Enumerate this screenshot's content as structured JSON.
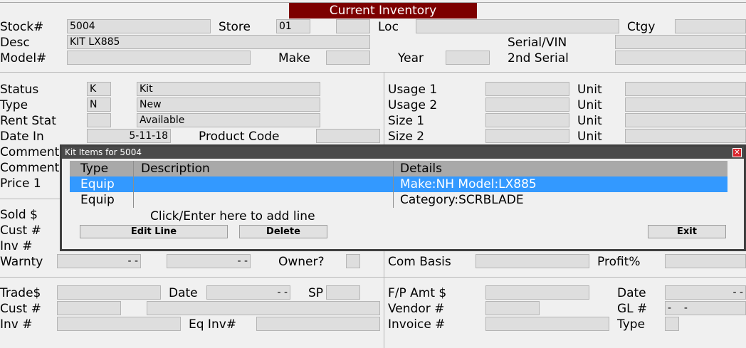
{
  "window": {
    "title": "Current Inventory"
  },
  "header": {
    "stock_label": "Stock#",
    "stock_value": "5004",
    "store_label": "Store",
    "store_value": "01",
    "store_value2": "",
    "loc_label": "Loc",
    "loc_value": "",
    "ctgy_label": "Ctgy",
    "ctgy_value": "",
    "desc_label": "Desc",
    "desc_value": "KIT LX885",
    "serial_label": "Serial/VIN",
    "serial_value": "",
    "model_label": "Model#",
    "model_value": "",
    "make_label": "Make",
    "make_value": "",
    "year_label": "Year",
    "year_value": "",
    "serial2_label": "2nd Serial",
    "serial2_value": ""
  },
  "status": {
    "status_label": "Status",
    "status_code": "K",
    "status_text": "Kit",
    "type_label": "Type",
    "type_code": "N",
    "type_text": "New",
    "rent_label": "Rent Stat",
    "rent_code": "",
    "rent_text": "Available",
    "datein_label": "Date In",
    "datein_value": "5-11-18",
    "product_code_label": "Product Code",
    "product_code_value": "",
    "comment1_label": "Comment",
    "comment2_label": "Comment",
    "price1_label": "Price 1"
  },
  "usage": {
    "usage1_label": "Usage 1",
    "usage2_label": "Usage 2",
    "size1_label": "Size 1",
    "size2_label": "Size 2",
    "unit_label": "Unit"
  },
  "sale": {
    "sold_label": "Sold $",
    "cust_label": "Cust #",
    "inv_label": "Inv #",
    "warnty_label": "Warnty",
    "warnty_value1": "- -",
    "warnty_value2": "- -",
    "owner_label": "Owner?",
    "com_basis_label": "Com Basis",
    "profit_label": "Profit%"
  },
  "trade": {
    "trade_label": "Trade$",
    "date_label": "Date",
    "date_value": "- -",
    "sp_label": "SP",
    "cust_label": "Cust #",
    "inv_label": "Inv #",
    "eq_inv_label": "Eq Inv#",
    "fp_amt_label": "F/P Amt $",
    "vendor_label": "Vendor #",
    "invoice_label": "Invoice #",
    "date2_label": "Date",
    "date2_value": "- -",
    "gl_label": "GL #",
    "gl_value": "-    -",
    "type_label": "Type"
  },
  "kit_dialog": {
    "title": "Kit Items for 5004",
    "columns": [
      "Type",
      "Description",
      "Details"
    ],
    "rows": [
      {
        "type": "Equip",
        "description": "",
        "details": "Make:NH Model:LX885"
      },
      {
        "type": "Equip",
        "description": "",
        "details": "Category:SCRBLADE"
      }
    ],
    "add_line_text": "Click/Enter here to add line",
    "edit_button": "Edit Line",
    "delete_button": "Delete",
    "exit_button": "Exit"
  }
}
